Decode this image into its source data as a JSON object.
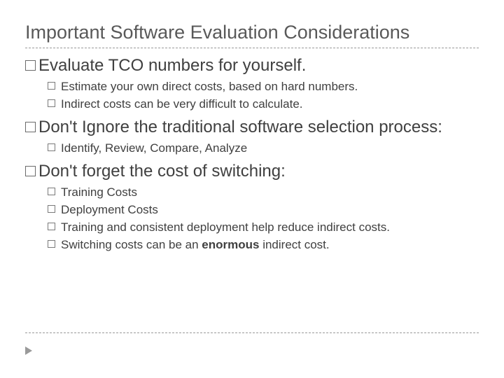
{
  "title": "Important Software Evaluation Considerations",
  "bullets": [
    {
      "text": "Evaluate TCO numbers for yourself.",
      "sub": [
        {
          "text": "Estimate your own direct costs, based on hard numbers."
        },
        {
          "text": "Indirect costs can be very difficult to calculate."
        }
      ]
    },
    {
      "text": "Don't Ignore the traditional software selection process:",
      "sub": [
        {
          "text": "Identify, Review, Compare, Analyze"
        }
      ]
    },
    {
      "text": "Don't forget the cost of switching:",
      "sub": [
        {
          "text": "Training Costs"
        },
        {
          "text": "Deployment Costs"
        },
        {
          "text": "Training and consistent deployment help reduce indirect costs."
        },
        {
          "pre": "Switching costs can be an ",
          "strong": "enormous",
          "post": " indirect cost."
        }
      ]
    }
  ]
}
